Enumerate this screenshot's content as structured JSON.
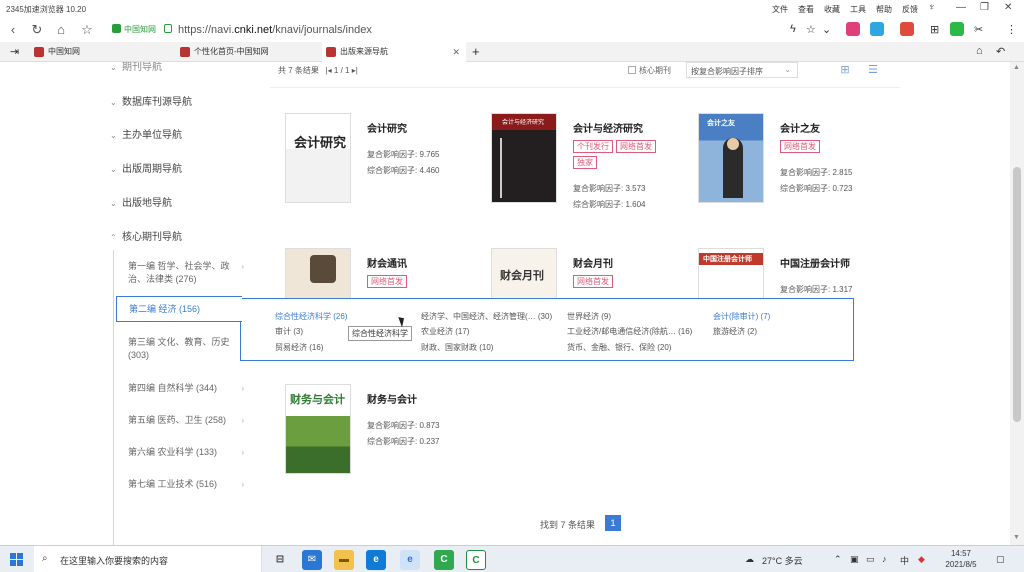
{
  "browser": {
    "title": "2345加速浏览器 10.20",
    "menus": [
      "文件",
      "查看",
      "收藏",
      "工具",
      "帮助",
      "反馈"
    ],
    "secure_label": "中国知网",
    "url_prefix": "https://navi.",
    "url_domain": "cnki.net",
    "url_path": "/knavi/journals/index",
    "tabs": [
      {
        "label": "中国知网"
      },
      {
        "label": "个性化首页-中国知网"
      },
      {
        "label": "出版来源导航"
      }
    ]
  },
  "sidebar": {
    "items": [
      {
        "label": "期刊导航"
      },
      {
        "label": "数据库刊源导航"
      },
      {
        "label": "主办单位导航"
      },
      {
        "label": "出版周期导航"
      },
      {
        "label": "出版地导航"
      },
      {
        "label": "核心期刊导航"
      }
    ],
    "sub_items": [
      {
        "label": "第一编 哲学、社会学、政治、法律类 (276)"
      },
      {
        "label": "第二编 经济 (156)"
      },
      {
        "label": "第三编 文化、教育、历史 (303)"
      },
      {
        "label": "第四编 自然科学 (344)"
      },
      {
        "label": "第五编 医药、卫生 (258)"
      },
      {
        "label": "第六编 农业科学 (133)"
      },
      {
        "label": "第七编 工业技术 (516)"
      }
    ]
  },
  "results": {
    "header": "共 7 条结果",
    "page_info": "1 / 1",
    "core_label": "核心期刊",
    "sort_label": "按复合影响因子排序",
    "footer": "找到 7 条结果",
    "current_page": "1"
  },
  "journals": [
    {
      "name": "会计研究",
      "tags": [],
      "metric1": "复合影响因子: 9.765",
      "metric2": "综合影响因子: 4.460"
    },
    {
      "name": "会计与经济研究",
      "tags": [
        "个刊发行",
        "网络首发",
        "独家"
      ],
      "metric1": "复合影响因子: 3.573",
      "metric2": "综合影响因子: 1.604"
    },
    {
      "name": "会计之友",
      "tags": [
        "网络首发"
      ],
      "metric1": "复合影响因子: 2.815",
      "metric2": "综合影响因子: 0.723"
    },
    {
      "name": "财会通讯",
      "tags": [
        "网络首发"
      ]
    },
    {
      "name": "财会月刊",
      "tags": [
        "网络首发"
      ]
    },
    {
      "name": "中国注册会计师",
      "metric1": "复合影响因子: 1.317"
    },
    {
      "name": "财务与会计",
      "metric1": "复合影响因子: 0.873",
      "metric2": "综合影响因子: 0.237"
    }
  ],
  "popup": {
    "items": [
      {
        "label": "综合性经济科学 (26)"
      },
      {
        "label": "审计 (3)"
      },
      {
        "label": "贸易经济 (16)"
      },
      {
        "label": "经济学、中国经济、经济管理(… (30)"
      },
      {
        "label": "农业经济 (17)"
      },
      {
        "label": "财政、国家财政 (10)"
      },
      {
        "label": "世界经济 (9)"
      },
      {
        "label": "工业经济/邮电通信经济(除航… (16)"
      },
      {
        "label": "货币、金融、银行、保险 (20)"
      },
      {
        "label": "会计(除审计) (7)"
      },
      {
        "label": "旅游经济 (2)"
      }
    ],
    "tooltip": "综合性经济科学"
  },
  "taskbar": {
    "search_placeholder": "在这里输入你要搜索的内容",
    "weather": "27°C 多云",
    "ime": "中",
    "time": "14:57",
    "date": "2021/8/5"
  },
  "colors": {
    "accent": "#3a7bd5",
    "tag": "#e05a7a",
    "secure": "#2a9d3b"
  }
}
